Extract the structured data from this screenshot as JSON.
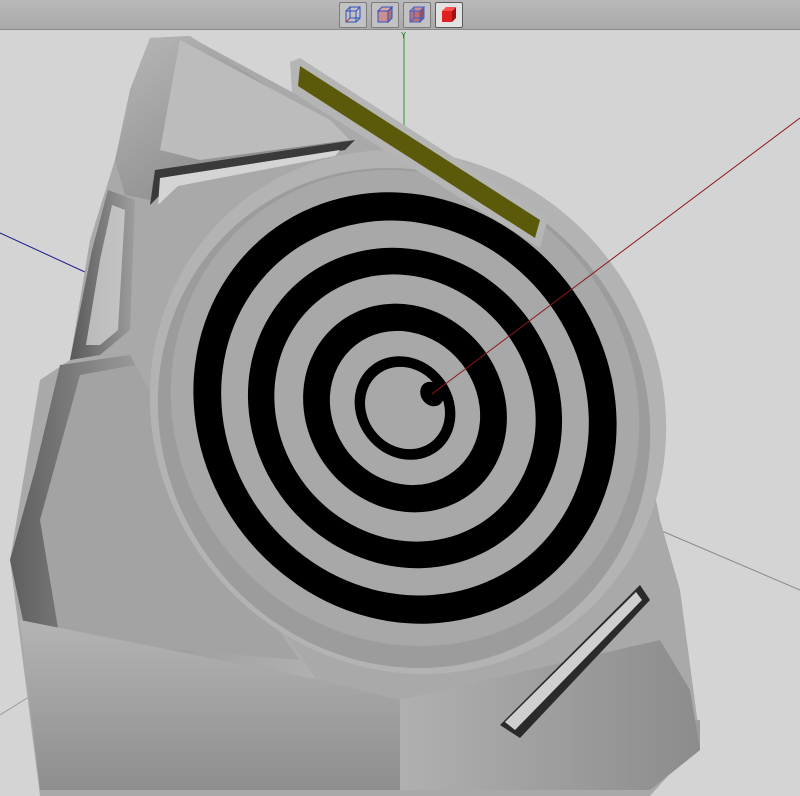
{
  "toolbar": {
    "view_buttons": [
      {
        "icon": "wireframe-cube-icon"
      },
      {
        "icon": "wireframe-shaded-cube-icon"
      },
      {
        "icon": "shaded-wireframe-cube-icon"
      },
      {
        "icon": "solid-red-cube-icon",
        "active": true
      }
    ]
  },
  "viewport": {
    "axes": {
      "y_label": "Y",
      "y_color": "#2a9a2a",
      "x_color": "#8a1a1a",
      "z_color": "#1a1a8a"
    },
    "model": {
      "body_color": "#a6a6a6",
      "target_ring_color": "#000000",
      "target_face_color": "#a8a8a8",
      "label_strip_color": "#5a5a0a",
      "target_ring_count": 4
    }
  }
}
